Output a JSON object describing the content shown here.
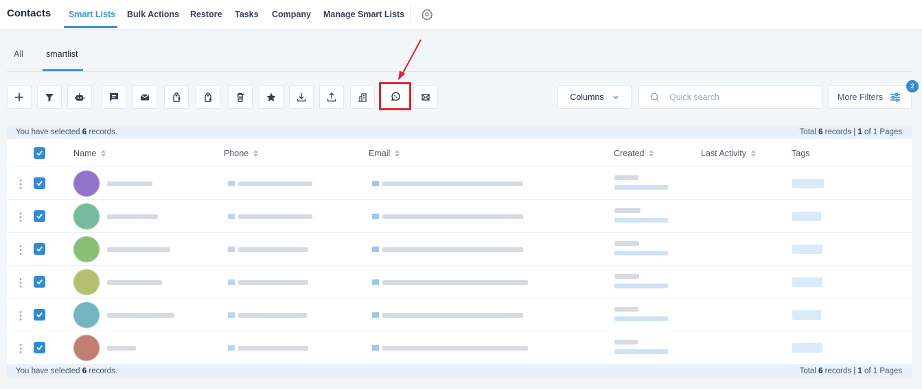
{
  "topnav": {
    "title": "Contacts",
    "items": [
      {
        "label": "Smart Lists",
        "active": true
      },
      {
        "label": "Bulk Actions"
      },
      {
        "label": "Restore"
      },
      {
        "label": "Tasks"
      },
      {
        "label": "Company"
      },
      {
        "label": "Manage Smart Lists"
      }
    ],
    "settings_icon": "gear-icon"
  },
  "subtabs": [
    {
      "label": "All"
    },
    {
      "label": "smartlist",
      "active": true
    }
  ],
  "toolbar": {
    "buttons": [
      {
        "icon": "plus-icon"
      },
      {
        "icon": "filter-icon"
      },
      {
        "icon": "robot-icon"
      },
      {
        "icon": "message-icon"
      },
      {
        "icon": "email-icon"
      },
      {
        "icon": "tag-add-icon"
      },
      {
        "icon": "tag-remove-icon"
      },
      {
        "icon": "trash-icon"
      },
      {
        "icon": "star-icon"
      },
      {
        "icon": "download-icon"
      },
      {
        "icon": "upload-icon"
      },
      {
        "icon": "company-icon"
      },
      {
        "icon": "whatsapp-icon",
        "highlighted": true
      },
      {
        "icon": "merge-icon"
      }
    ],
    "columns_label": "Columns",
    "search_placeholder": "Quick search",
    "more_filters_label": "More Filters",
    "filters_badge": "2"
  },
  "selection": {
    "prefix": "You have selected",
    "count": "6",
    "suffix": "records."
  },
  "totals": {
    "prefix": "Total",
    "count": "6",
    "middle": "records |",
    "page": "1",
    "of_pages": "of 1 Pages"
  },
  "table": {
    "headers": {
      "name": "Name",
      "phone": "Phone",
      "email": "Email",
      "created": "Created",
      "last_activity": "Last Activity",
      "tags": "Tags"
    },
    "rows": [
      {
        "avatar_color": "#7e5bc2",
        "selected": true
      },
      {
        "avatar_color": "#5fb08a",
        "selected": true
      },
      {
        "avatar_color": "#74b35f",
        "selected": true
      },
      {
        "avatar_color": "#a9b55a",
        "selected": true
      },
      {
        "avatar_color": "#5aa9b4",
        "selected": true
      },
      {
        "avatar_color": "#b56a5a",
        "selected": true
      }
    ]
  },
  "colors": {
    "accent": "#3b94d9",
    "highlight": "#e0242a",
    "checkbox": "#2f8bd8"
  }
}
